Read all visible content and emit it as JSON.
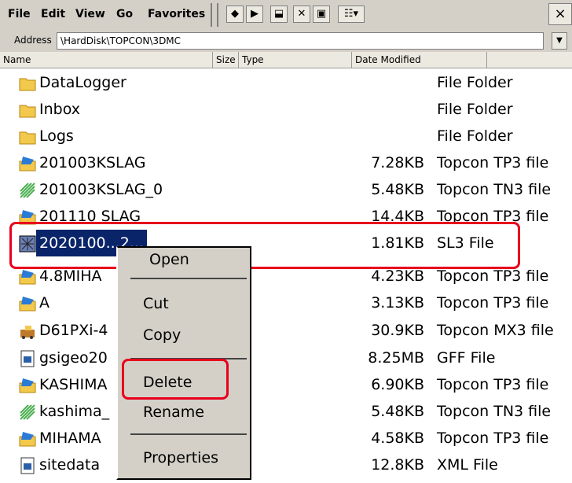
{
  "menubar": {
    "items": [
      "File",
      "Edit",
      "View",
      "Go",
      "Favorites"
    ],
    "close": "×"
  },
  "address": {
    "label": "Address",
    "value": "\\HardDisk\\TOPCON\\3DMC"
  },
  "columns": {
    "name": "Name",
    "size": "Size",
    "type": "Type",
    "date": "Date Modified"
  },
  "files": [
    {
      "name": "DataLogger",
      "size": "",
      "type": "File Folder",
      "icon": "folder-icon"
    },
    {
      "name": "Inbox",
      "size": "",
      "type": "File Folder",
      "icon": "folder-icon"
    },
    {
      "name": "Logs",
      "size": "",
      "type": "File Folder",
      "icon": "folder-icon"
    },
    {
      "name": "201003KSLAG",
      "size": "7.28KB",
      "type": "Topcon TP3 file",
      "icon": "tp3-file-icon"
    },
    {
      "name": "201003KSLAG_0",
      "size": "5.48KB",
      "type": "Topcon TN3 file",
      "icon": "tn3-file-icon"
    },
    {
      "name": "201110 SLAG",
      "size": "14.4KB",
      "type": "Topcon TP3 file",
      "icon": "tp3-file-icon"
    },
    {
      "name": "2020100...2...",
      "size": "1.81KB",
      "type": "SL3 File",
      "icon": "sl3-file-icon"
    },
    {
      "name": "4.8MIHA",
      "size": "4.23KB",
      "type": "Topcon TP3 file",
      "icon": "tp3-file-icon"
    },
    {
      "name": "A",
      "size": "3.13KB",
      "type": "Topcon TP3 file",
      "icon": "tp3-file-icon"
    },
    {
      "name": "D61PXi-4",
      "size": "30.9KB",
      "type": "Topcon MX3 file",
      "icon": "mx3-file-icon"
    },
    {
      "name": "gsigeo20",
      "size": "8.25MB",
      "type": "GFF File",
      "icon": "gff-file-icon"
    },
    {
      "name": "KASHIMA",
      "size": "6.90KB",
      "type": "Topcon TP3 file",
      "icon": "tp3-file-icon"
    },
    {
      "name": "kashima_",
      "size": "5.48KB",
      "type": "Topcon TN3 file",
      "icon": "tn3-file-icon"
    },
    {
      "name": "MIHAMA",
      "size": "4.58KB",
      "type": "Topcon TP3 file",
      "icon": "tp3-file-icon"
    },
    {
      "name": "sitedata",
      "size": "12.8KB",
      "type": "XML File",
      "icon": "xml-file-icon"
    }
  ],
  "context_menu": {
    "open": "Open",
    "cut": "Cut",
    "copy": "Copy",
    "delete": "Delete",
    "rename": "Rename",
    "properties": "Properties"
  },
  "colors": {
    "selection": "#0a246a",
    "highlight": "#e8001c",
    "chrome": "#d4d0c8"
  }
}
